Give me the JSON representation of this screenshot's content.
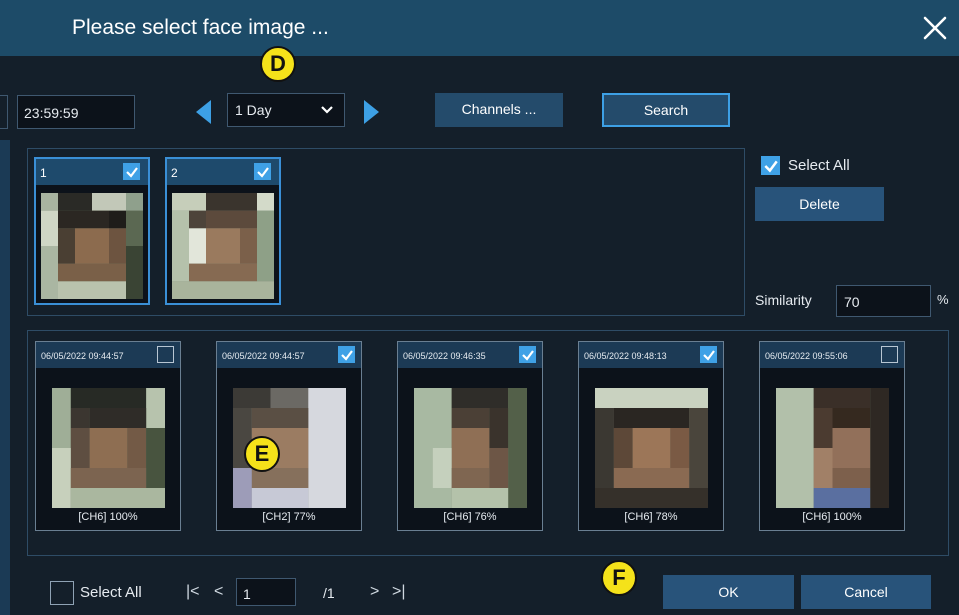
{
  "dialog": {
    "title": "Please select face image ..."
  },
  "toolbar": {
    "end_time": "23:59:59",
    "period_value": "1 Day",
    "channels_label": "Channels ...",
    "search_label": "Search"
  },
  "badges": {
    "d": "D",
    "e": "E",
    "f": "F"
  },
  "selected_faces": [
    {
      "number": "1",
      "checked": true
    },
    {
      "number": "2",
      "checked": true
    }
  ],
  "side": {
    "select_all_label": "Select All",
    "select_all_checked": true,
    "delete_label": "Delete",
    "similarity_label": "Similarity",
    "similarity_value": "70",
    "percent_sign": "%"
  },
  "results": [
    {
      "timestamp": "06/05/2022 09:44:57",
      "caption": "[CH6] 100%",
      "checked": false
    },
    {
      "timestamp": "06/05/2022 09:44:57",
      "caption": "[CH2] 77%",
      "checked": true
    },
    {
      "timestamp": "06/05/2022 09:46:35",
      "caption": "[CH6] 76%",
      "checked": true
    },
    {
      "timestamp": "06/05/2022 09:48:13",
      "caption": "[CH6] 78%",
      "checked": true
    },
    {
      "timestamp": "06/05/2022 09:55:06",
      "caption": "[CH6] 100%",
      "checked": false
    }
  ],
  "footer": {
    "select_all_label": "Select All",
    "select_all_checked": false,
    "page_value": "1",
    "page_total": "/1",
    "ok_label": "OK",
    "cancel_label": "Cancel"
  },
  "colors": {
    "accent": "#3da0e5",
    "titlebar": "#1d4b68",
    "badge": "#f5e21a"
  }
}
